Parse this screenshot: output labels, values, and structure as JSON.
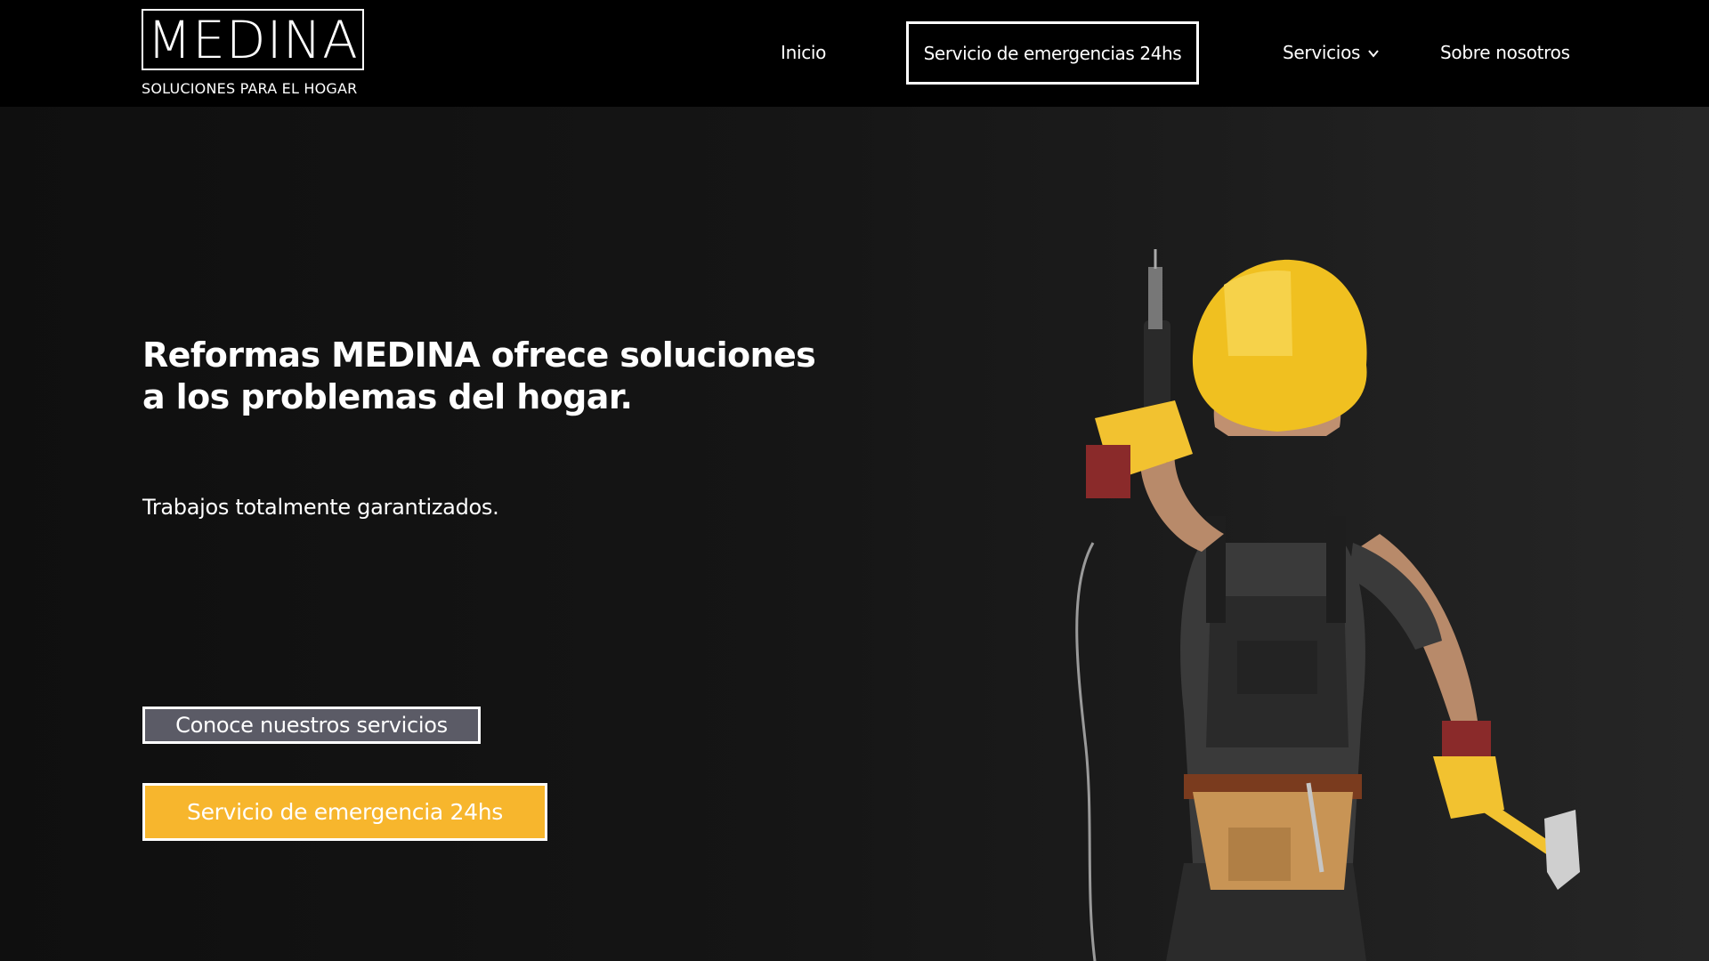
{
  "brand": {
    "logo_text": "MEDINA",
    "tagline": "SOLUCIONES PARA EL HOGAR"
  },
  "nav": {
    "inicio": "Inicio",
    "emergency": "Servicio de emergencias 24hs",
    "servicios": "Servicios",
    "about": "Sobre nosotros"
  },
  "hero": {
    "title": "Reformas MEDINA ofrece soluciones a los problemas del hogar.",
    "subtitle": "Trabajos totalmente garantizados.",
    "services_button": "Conoce nuestros servicios",
    "emergency_button": "Servicio de emergencia 24hs"
  },
  "icons": {
    "dropdown": "chevron-down-icon"
  },
  "colors": {
    "navbar_bg": "#000000",
    "hero_bg": "#151515",
    "accent_yellow": "#f7b62d",
    "services_button_bg": "#5b5b66",
    "text": "#ffffff"
  }
}
